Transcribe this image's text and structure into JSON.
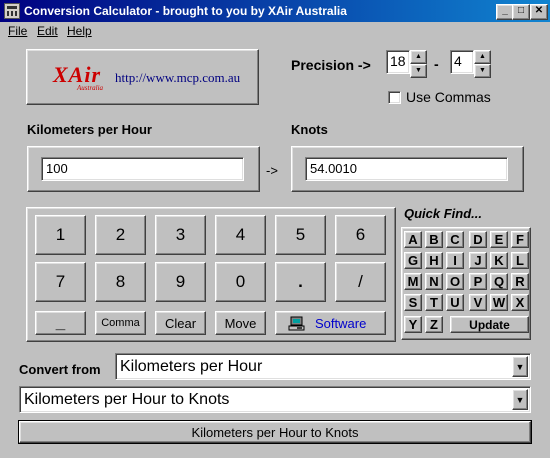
{
  "window": {
    "title": "Conversion Calculator - brought to you by XAir Australia",
    "minimize_glyph": "_",
    "maximize_glyph": "□",
    "close_glyph": "✕"
  },
  "menu": {
    "file": "File",
    "edit": "Edit",
    "help": "Help"
  },
  "logo": {
    "brand": "XAir",
    "sub": "Australia",
    "url": "http://www.mcp.com.au"
  },
  "precision": {
    "label": "Precision ->",
    "total_digits": "18",
    "separator": "-",
    "decimals": "4",
    "use_commas_label": "Use Commas",
    "use_commas": false
  },
  "from_unit": {
    "label": "Kilometers per Hour",
    "value": "100"
  },
  "arrow": "->",
  "to_unit": {
    "label": "Knots",
    "value": "54.0010"
  },
  "keypad": {
    "row1": [
      "1",
      "2",
      "3",
      "4",
      "5",
      "6"
    ],
    "row2": [
      "7",
      "8",
      "9",
      "0",
      ".",
      "/"
    ],
    "minus": "_",
    "comma": "Comma",
    "clear": "Clear",
    "move": "Move",
    "software": "Software"
  },
  "quick_find": {
    "title": "Quick Find...",
    "rows": [
      [
        "A",
        "B",
        "C",
        "D",
        "E",
        "F"
      ],
      [
        "G",
        "H",
        "I",
        "J",
        "K",
        "L"
      ],
      [
        "M",
        "N",
        "O",
        "P",
        "Q",
        "R"
      ],
      [
        "S",
        "T",
        "U",
        "V",
        "W",
        "X"
      ]
    ],
    "last_row": [
      "Y",
      "Z"
    ],
    "update": "Update"
  },
  "convert_from": {
    "label": "Convert from",
    "selected": "Kilometers per Hour"
  },
  "conversion": {
    "selected": "Kilometers per Hour to Knots"
  },
  "status": {
    "text": "Kilometers per Hour to Knots"
  },
  "colors": {
    "titlebar_start": "#000080",
    "titlebar_end": "#1084d0",
    "face": "#c0c0c0",
    "logo_red": "#cc0000",
    "link_navy": "#000080",
    "software_blue": "#0000cc"
  }
}
